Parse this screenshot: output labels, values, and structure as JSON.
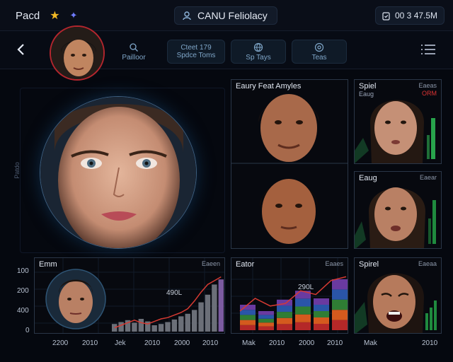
{
  "topbar": {
    "app_name": "Pacd",
    "title": "CANU Feliolacy",
    "clock": "00 3 47.5M"
  },
  "nav": {
    "buttons": [
      {
        "label": "Pailloor",
        "sub": "",
        "icon": "search-icon"
      },
      {
        "label": "Cteet 179",
        "sub": "Spdce Toms",
        "icon": ""
      },
      {
        "label": "Sp Tays",
        "sub": "",
        "icon": "globe-icon"
      },
      {
        "label": "Teas",
        "sub": "",
        "icon": "target-icon"
      }
    ]
  },
  "side_label": "Patdo",
  "panels": {
    "analysis": {
      "title": "Eaury Feat Amyles"
    },
    "spiel_top": {
      "title": "Spiel",
      "sub": "Eaug",
      "tag": "Eaeas",
      "tag2": "ORM"
    },
    "spiel_mid": {
      "title": "Eaug",
      "tag": "Eaear"
    },
    "emm": {
      "title": "Emm",
      "tag": "Eaeen",
      "annotation": "490L"
    },
    "eator": {
      "title": "Eator",
      "tag": "Eaaes",
      "annotation": "290L"
    },
    "spirel": {
      "title": "Spirel",
      "tag": "Eaeaa"
    }
  },
  "chart_data": [
    {
      "type": "bar",
      "title": "Emm",
      "yticks": [
        "100",
        "200",
        "400",
        "0"
      ],
      "xticks": [
        "2200",
        "2010",
        "Jek",
        "2010",
        "2000",
        "2010"
      ],
      "values": [
        12,
        15,
        18,
        14,
        20,
        16,
        10,
        12,
        15,
        19,
        24,
        28,
        34,
        46,
        58,
        74,
        82
      ],
      "line": [
        6,
        10,
        14,
        18,
        14,
        12,
        16,
        20,
        22,
        26,
        30,
        36,
        48,
        62,
        74,
        80,
        86
      ]
    },
    {
      "type": "bar",
      "title": "Eator",
      "xticks": [
        "Mak",
        "2010",
        "2000",
        "2010"
      ],
      "values": [
        40,
        30,
        48,
        62,
        50,
        80
      ],
      "line": [
        30,
        50,
        38,
        42,
        62,
        56,
        78,
        84
      ]
    }
  ],
  "panel_xticks": {
    "spirel": [
      "Mak",
      "2010"
    ]
  }
}
